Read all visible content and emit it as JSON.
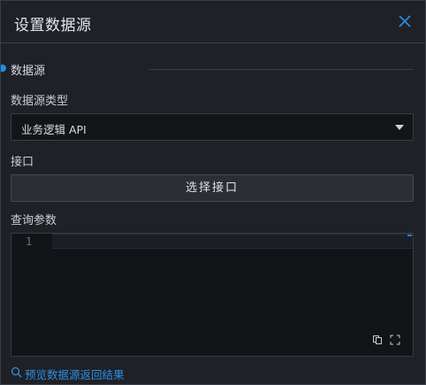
{
  "dialog": {
    "title": "设置数据源",
    "close_icon": "close-icon"
  },
  "section": {
    "title": "数据源"
  },
  "datasource_type": {
    "label": "数据源类型",
    "value": "业务逻辑 API"
  },
  "api": {
    "label": "接口",
    "button_label": "选择接口"
  },
  "query_params": {
    "label": "查询参数",
    "line_numbers": [
      "1"
    ],
    "icons": [
      "copy-icon",
      "fullscreen-icon"
    ]
  },
  "preview": {
    "label": "预览数据源返回结果",
    "icon": "search-icon"
  },
  "colors": {
    "accent": "#2b8fe3",
    "background": "#1f2126",
    "editor_background": "#131418"
  }
}
